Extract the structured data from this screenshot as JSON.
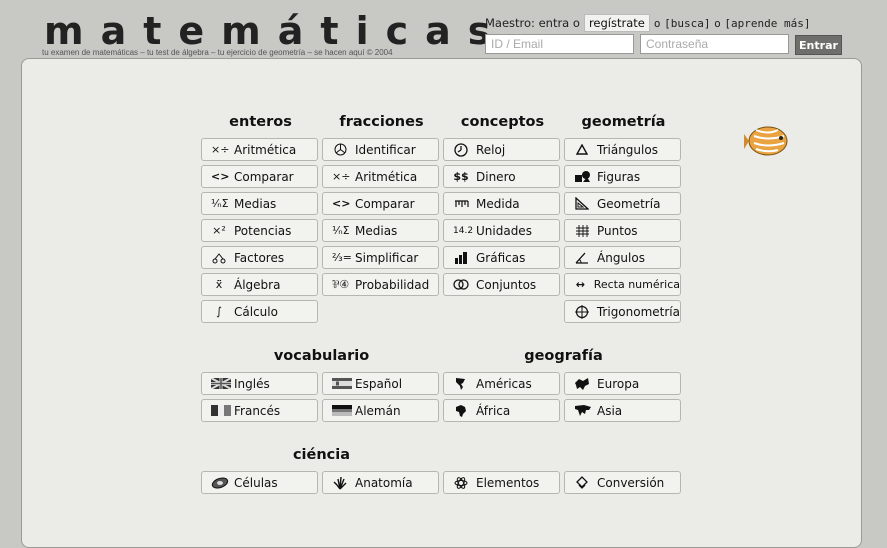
{
  "header": {
    "logo": "matemáticas",
    "tagline": "tu examen de matemáticas – tu test de álgebra – tu ejercicio de geometría – se hacen aquí © 2004"
  },
  "auth": {
    "prefix": "Maestro: entra o",
    "register": "regístrate",
    "sep1": "o",
    "busca": "[busca]",
    "sep2": "o",
    "aprende": "[aprende más]",
    "email_placeholder": "ID / Email",
    "password_placeholder": "Contraseña",
    "submit": "Entrar"
  },
  "sections": {
    "enteros": "enteros",
    "fracciones": "fracciones",
    "conceptos": "conceptos",
    "geometria": "geometría",
    "vocabulario": "vocabulario",
    "geografia": "geografía",
    "ciencia": "ciéncia"
  },
  "enteros": [
    {
      "label": "Aritmética",
      "icon": "arithmetic-icon"
    },
    {
      "label": "Comparar",
      "icon": "compare-icon"
    },
    {
      "label": "Medias",
      "icon": "sigma-icon"
    },
    {
      "label": "Potencias",
      "icon": "power-icon"
    },
    {
      "label": "Factores",
      "icon": "factor-tree-icon"
    },
    {
      "label": "Álgebra",
      "icon": "algebra-icon"
    },
    {
      "label": "Cálculo",
      "icon": "integral-icon"
    }
  ],
  "fracciones": [
    {
      "label": "Identificar",
      "icon": "pie-icon"
    },
    {
      "label": "Aritmética",
      "icon": "arithmetic-icon"
    },
    {
      "label": "Comparar",
      "icon": "compare-icon"
    },
    {
      "label": "Medias",
      "icon": "sigma-icon"
    },
    {
      "label": "Simplificar",
      "icon": "fraction-icon"
    },
    {
      "label": "Probabilidad",
      "icon": "probability-icon"
    }
  ],
  "conceptos": [
    {
      "label": "Reloj",
      "icon": "clock-icon"
    },
    {
      "label": "Dinero",
      "icon": "money-icon"
    },
    {
      "label": "Medida",
      "icon": "ruler-icon"
    },
    {
      "label": "Unidades",
      "icon": "units-icon"
    },
    {
      "label": "Gráficas",
      "icon": "bar-chart-icon"
    },
    {
      "label": "Conjuntos",
      "icon": "sets-icon"
    }
  ],
  "geometria": [
    {
      "label": "Triángulos",
      "icon": "triangle-icon"
    },
    {
      "label": "Figuras",
      "icon": "shapes-icon"
    },
    {
      "label": "Geometría",
      "icon": "set-square-icon"
    },
    {
      "label": "Puntos",
      "icon": "grid-points-icon"
    },
    {
      "label": "Ángulos",
      "icon": "angle-icon"
    },
    {
      "label": "Recta numérica",
      "icon": "number-line-icon"
    },
    {
      "label": "Trigonometría",
      "icon": "unit-circle-icon"
    }
  ],
  "vocabulario": [
    {
      "label": "Inglés",
      "icon": "uk-flag-icon"
    },
    {
      "label": "Español",
      "icon": "spain-flag-icon"
    },
    {
      "label": "Francés",
      "icon": "france-flag-icon"
    },
    {
      "label": "Alemán",
      "icon": "germany-flag-icon"
    }
  ],
  "geografia": [
    {
      "label": "Américas",
      "icon": "americas-map-icon"
    },
    {
      "label": "Europa",
      "icon": "europe-map-icon"
    },
    {
      "label": "África",
      "icon": "africa-map-icon"
    },
    {
      "label": "Asia",
      "icon": "asia-map-icon"
    }
  ],
  "ciencia": [
    {
      "label": "Células",
      "icon": "cell-icon"
    },
    {
      "label": "Anatomía",
      "icon": "hand-icon"
    },
    {
      "label": "Elementos",
      "icon": "atom-icon"
    },
    {
      "label": "Conversión",
      "icon": "conversion-icon"
    }
  ],
  "colors": {
    "page_bg": "#c8c8c4",
    "panel_bg": "#ebebe7",
    "button_bg": "#f2f2ee",
    "submit_bg": "#6e6e6a"
  }
}
